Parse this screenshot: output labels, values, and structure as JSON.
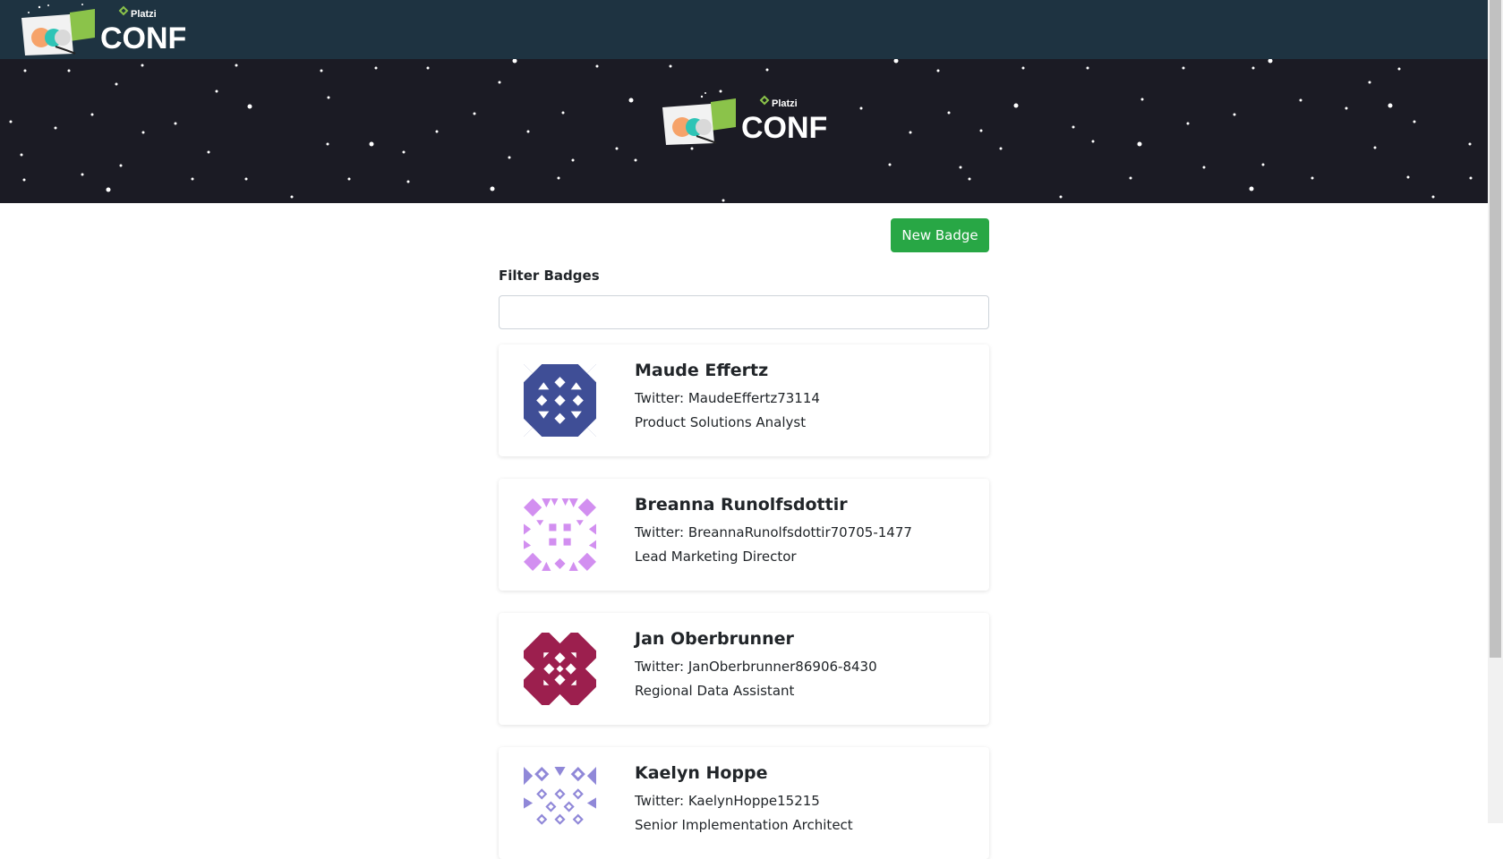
{
  "navbar": {
    "logo_brand": "Platzi",
    "logo_word": "CONF"
  },
  "hero": {
    "logo_brand": "Platzi",
    "logo_word": "CONF"
  },
  "actions": {
    "new_badge_label": "New Badge"
  },
  "filter": {
    "label": "Filter Badges",
    "value": "",
    "placeholder": ""
  },
  "badges": [
    {
      "name": "Maude Effertz",
      "twitter_prefix": "Twitter:",
      "twitter": "MaudeEffertz73114",
      "job": "Product Solutions Analyst",
      "avatar_color": "#3f4e96"
    },
    {
      "name": "Breanna Runolfsdottir",
      "twitter_prefix": "Twitter:",
      "twitter": "BreannaRunolfsdottir70705-1477",
      "job": "Lead Marketing Director",
      "avatar_color": "#d28ff0"
    },
    {
      "name": "Jan Oberbrunner",
      "twitter_prefix": "Twitter:",
      "twitter": "JanOberbrunner86906-8430",
      "job": "Regional Data Assistant",
      "avatar_color": "#9c1f4e"
    },
    {
      "name": "Kaelyn Hoppe",
      "twitter_prefix": "Twitter:",
      "twitter": "KaelynHoppe15215",
      "job": "Senior Implementation Architect",
      "avatar_color": "#9088d8"
    }
  ],
  "colors": {
    "navbar_bg": "#1e3341",
    "hero_bg": "#1b1b24",
    "accent_green": "#28a745",
    "logo_green": "#8bc34a"
  }
}
